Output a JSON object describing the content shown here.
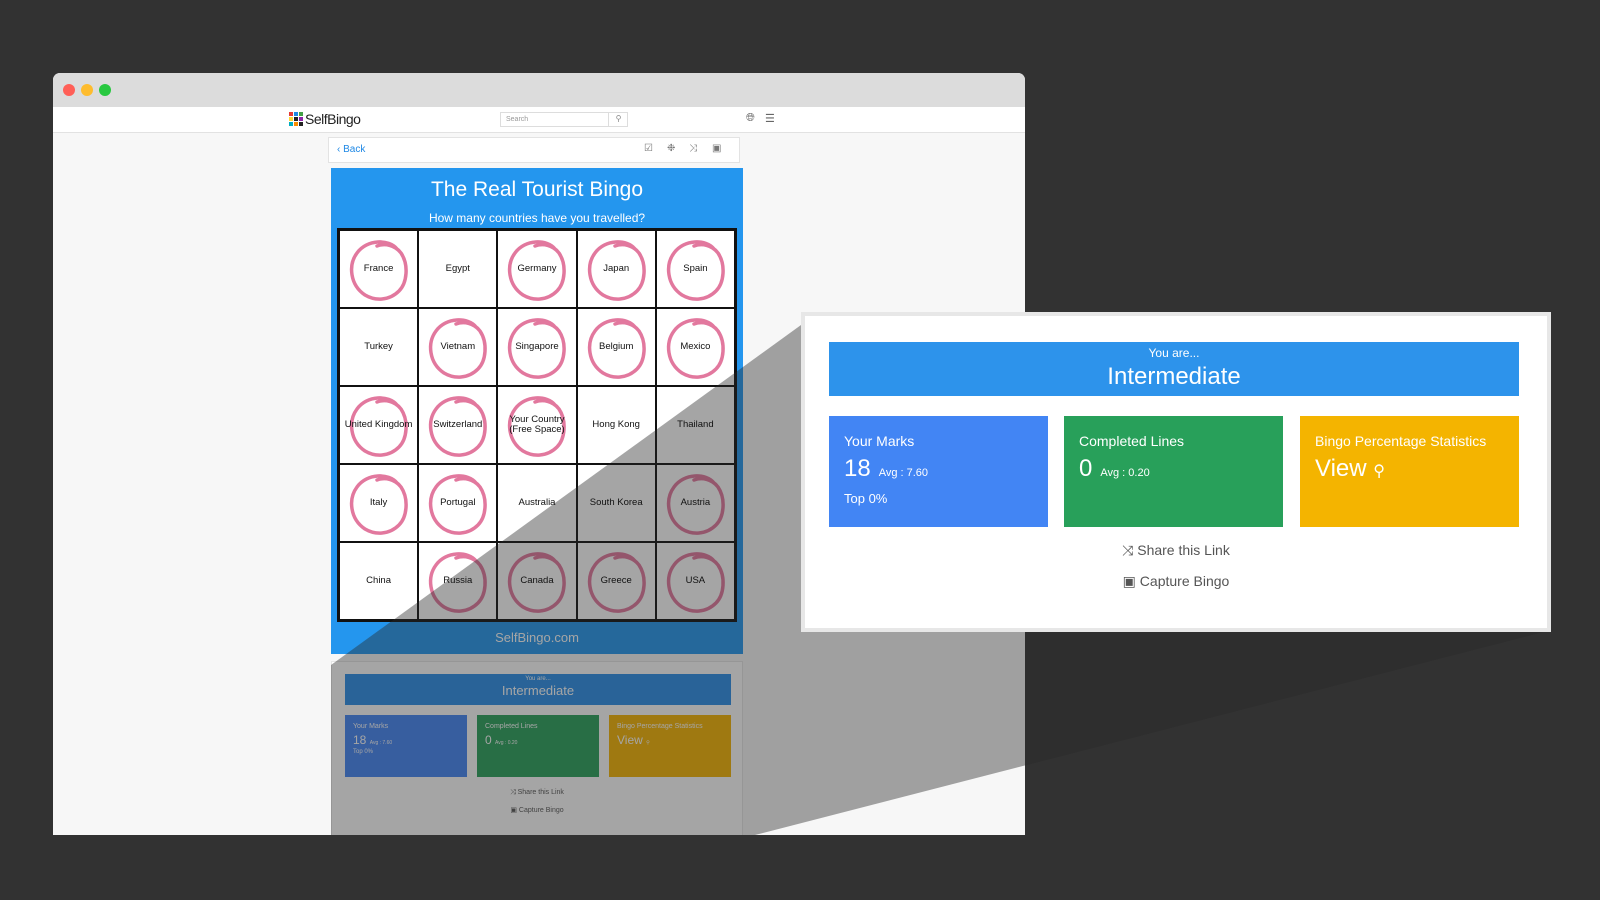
{
  "site": {
    "logo_text": "SelfBingo",
    "search_placeholder": "Search",
    "brand_footer": "SelfBingo.com"
  },
  "toolbar": {
    "back_label": "Back"
  },
  "bingo": {
    "title": "The Real Tourist Bingo",
    "subtitle": "How many countries have you travelled?",
    "cells": [
      {
        "label": "France",
        "marked": true
      },
      {
        "label": "Egypt",
        "marked": false
      },
      {
        "label": "Germany",
        "marked": true
      },
      {
        "label": "Japan",
        "marked": true
      },
      {
        "label": "Spain",
        "marked": true
      },
      {
        "label": "Turkey",
        "marked": false
      },
      {
        "label": "Vietnam",
        "marked": true
      },
      {
        "label": "Singapore",
        "marked": true
      },
      {
        "label": "Belgium",
        "marked": true
      },
      {
        "label": "Mexico",
        "marked": true
      },
      {
        "label": "United Kingdom",
        "marked": true
      },
      {
        "label": "Switzerland",
        "marked": true
      },
      {
        "label": "Your Country (Free Space)",
        "marked": true
      },
      {
        "label": "Hong Kong",
        "marked": false
      },
      {
        "label": "Thailand",
        "marked": false
      },
      {
        "label": "Italy",
        "marked": true
      },
      {
        "label": "Portugal",
        "marked": true
      },
      {
        "label": "Australia",
        "marked": false
      },
      {
        "label": "South Korea",
        "marked": false
      },
      {
        "label": "Austria",
        "marked": true
      },
      {
        "label": "China",
        "marked": false
      },
      {
        "label": "Russia",
        "marked": true
      },
      {
        "label": "Canada",
        "marked": true
      },
      {
        "label": "Greece",
        "marked": true
      },
      {
        "label": "USA",
        "marked": true
      }
    ],
    "mark_color": "#e2789e"
  },
  "result": {
    "you_are": "You are...",
    "level": "Intermediate",
    "marks_title": "Your Marks",
    "marks_value": "18",
    "marks_avg": "Avg : 7.60",
    "marks_top": "Top 0%",
    "lines_title": "Completed Lines",
    "lines_value": "0",
    "lines_avg": "Avg : 0.20",
    "stats_title": "Bingo Percentage Statistics",
    "stats_view": "View",
    "share_link": "Share this Link",
    "capture": "Capture Bingo"
  },
  "colors": {
    "banner_blue": "#2d93eb",
    "marks_blue": "#4285f4",
    "lines_green": "#28a05a",
    "stats_yellow": "#f4b400"
  }
}
